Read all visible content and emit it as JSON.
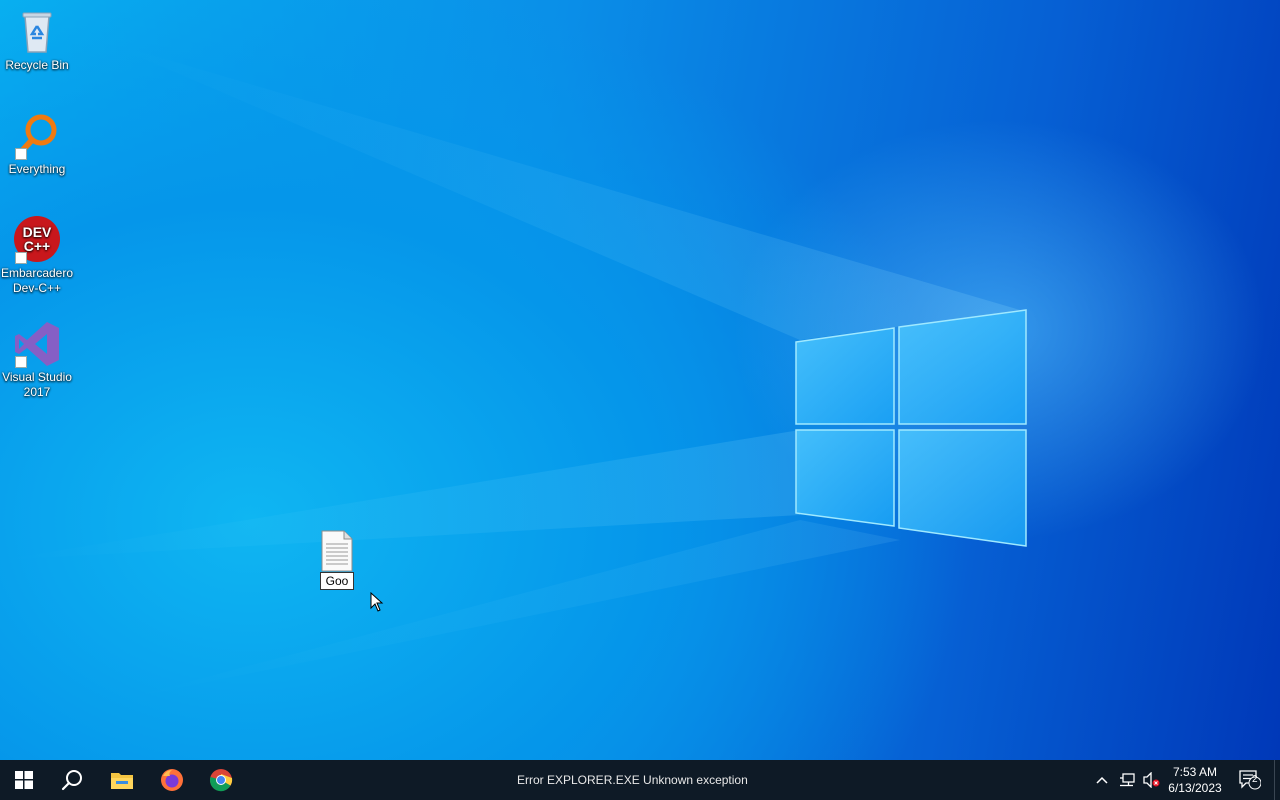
{
  "desktop": {
    "icons": [
      {
        "label": "Recycle Bin",
        "icon": "recycle-bin-icon"
      },
      {
        "label": "Everything",
        "icon": "everything-search-icon"
      },
      {
        "label": "Embarcadero Dev-C++",
        "icon": "devcpp-icon"
      },
      {
        "label": "Visual Studio 2017",
        "icon": "visual-studio-icon"
      }
    ],
    "file": {
      "rename_value": "Goo",
      "icon": "text-document-icon"
    }
  },
  "taskbar": {
    "start_icon": "windows-start-icon",
    "search_icon": "search-icon",
    "pinned": [
      {
        "name": "File Explorer",
        "icon": "file-explorer-icon"
      },
      {
        "name": "Firefox",
        "icon": "firefox-icon"
      },
      {
        "name": "Chrome",
        "icon": "chrome-icon"
      }
    ],
    "error_text": "Error EXPLORER.EXE Unknown exception",
    "tray": {
      "time": "7:53 AM",
      "date": "6/13/2023",
      "notification_count": "2"
    }
  },
  "colors": {
    "taskbar_bg": "#0e1a26",
    "desktop_accent": "#0a8fe8"
  }
}
